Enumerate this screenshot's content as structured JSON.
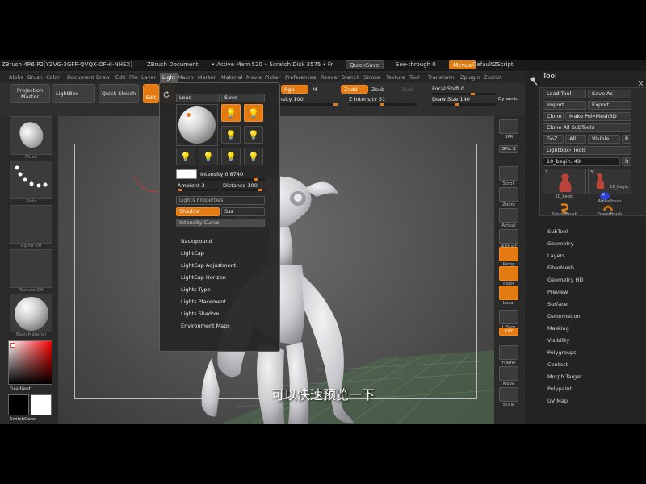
{
  "titlebar": {
    "app_title": "ZBrush 4R6 P2[YZVG-3GFF-QVQX-OFHI-NHEX]",
    "document": "ZBrush Document",
    "active_mem": "• Active Mem 520 • Scratch Disk 3575 • Fr",
    "quicksave": "QuickSave",
    "see_through": "See-through  0",
    "menus": "Menus",
    "default_script": "DefaultZScript"
  },
  "menubar": [
    "Alpha",
    "Brush",
    "Color",
    "Document",
    "Draw",
    "Edit",
    "File",
    "Layer",
    "Light",
    "Macro",
    "Marker",
    "Material",
    "Movie",
    "Picker",
    "Preferences",
    "Render",
    "Stencil",
    "Stroke",
    "Texture",
    "Tool",
    "Transform",
    "Zplugin",
    "Zscript"
  ],
  "menubar_active": "Light",
  "toolbar": {
    "projection_master": "Projection Master",
    "lightbox": "LightBox",
    "quick_sketch": "Quick Sketch",
    "edit": "Edit",
    "draw": "Dr",
    "rgb": "Rgb",
    "m": "M",
    "zadd": "Zadd",
    "zsub": "Zsub",
    "zcut": "Zcut",
    "intensity": "Intensity 100",
    "z_intensity": "Z Intensity 51",
    "focal_shift": "Focal Shift 0",
    "draw_size": "Draw Size 140",
    "dynamic": "Dynamic"
  },
  "left_shelf": {
    "brush_label": "Move",
    "stroke_label": "Dots",
    "alpha_label": "Alpha Off",
    "texture_label": "Texture Off",
    "material_label": "BasicMaterial",
    "gradient_label": "Gradient",
    "switch_color": "SwitchColor"
  },
  "right_shelf": [
    "BPR",
    "SPix 3",
    "Scroll",
    "Zoom",
    "Actual",
    "AAHalf",
    "Persp",
    "Floor",
    "Local",
    "L.Sym",
    "XYZ",
    "Frame",
    "Move",
    "Scale"
  ],
  "light_popup": {
    "load": "Load",
    "save": "Save",
    "intensity": "Intensity 0.8740",
    "ambient": "Ambient 3",
    "distance": "Distance 100",
    "lights_properties": "Lights Properties",
    "shadow": "Shadow",
    "sss": "Sss",
    "intensity_curve": "Intensity Curve",
    "items": [
      "Background",
      "LightCap",
      "LightCap Adjustment",
      "LightCap Horizon",
      "Lights Type",
      "Lights Placement",
      "Lights Shadow",
      "Environment Maps"
    ]
  },
  "tool_panel": {
    "title": "Tool",
    "load_tool": "Load Tool",
    "save_as": "Save As",
    "import": "Import",
    "export": "Export",
    "clone": "Clone",
    "make_polymesh": "Make PolyMesh3D",
    "clone_all": "Clone All SubTools",
    "goz": "GoZ",
    "all": "All",
    "visible": "Visible",
    "r": "R",
    "lightbox_tools": "Lightbox› Tools",
    "current_tool": "10_begin. 49",
    "thumbs": [
      "10_begin",
      "10_begin",
      "AlphaBrush",
      "SimpleBrush",
      "EraserBrush"
    ],
    "thumb_count_a": "3",
    "thumb_count_b": "3",
    "subpalettes": [
      "SubTool",
      "Geometry",
      "Layers",
      "FiberMesh",
      "Geometry HD",
      "Preview",
      "Surface",
      "Deformation",
      "Masking",
      "Visibility",
      "Polygroups",
      "Contact",
      "Morph Target",
      "Polypaint",
      "UV Map"
    ]
  },
  "subtitle": "可以快速预览一下"
}
